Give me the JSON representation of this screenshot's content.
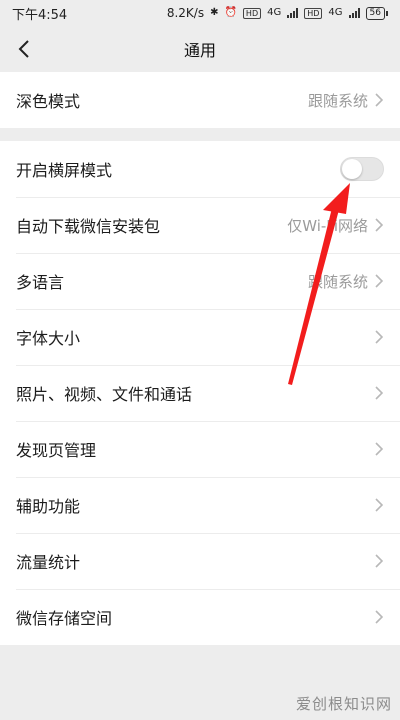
{
  "status_bar": {
    "time": "下午4:54",
    "speed": "8.2K/s",
    "network1": "4G",
    "network2": "4G",
    "battery": "56"
  },
  "nav": {
    "title": "通用"
  },
  "settings": {
    "dark_mode": {
      "label": "深色模式",
      "value": "跟随系统"
    },
    "landscape": {
      "label": "开启横屏模式",
      "enabled": false
    },
    "auto_download": {
      "label": "自动下载微信安装包",
      "value": "仅Wi-Fi网络"
    },
    "language": {
      "label": "多语言",
      "value": "跟随系统"
    },
    "font_size": {
      "label": "字体大小"
    },
    "media": {
      "label": "照片、视频、文件和通话"
    },
    "discover": {
      "label": "发现页管理"
    },
    "accessibility": {
      "label": "辅助功能"
    },
    "data_usage": {
      "label": "流量统计"
    },
    "storage": {
      "label": "微信存储空间"
    }
  },
  "watermark": "爱创根知识网",
  "colors": {
    "annotation_arrow": "#f21d1d"
  }
}
